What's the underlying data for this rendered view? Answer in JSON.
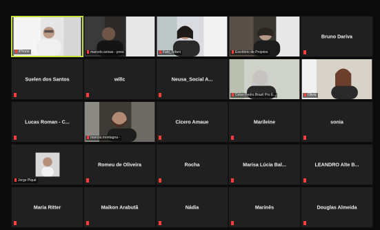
{
  "participants": [
    {
      "name": "iPhone",
      "video": true,
      "active": true
    },
    {
      "name": "marcelo.seixas - presi",
      "video": true
    },
    {
      "name": "Fabi_Tefani",
      "video": true
    },
    {
      "name": "Escritório de Projetos",
      "video": true
    },
    {
      "name": "Bruno Dariva",
      "video": false
    },
    {
      "name": "Suelen dos Santos",
      "video": false
    },
    {
      "name": "willc",
      "video": false
    },
    {
      "name": "Neusa_Social A...",
      "video": false
    },
    {
      "name": "Celso Pedro Brazil Pro E...",
      "video": true
    },
    {
      "name": "Olivia",
      "video": true
    },
    {
      "name": "Lucas Roman - C...",
      "video": false
    },
    {
      "name": "marcos.montagna -",
      "video": true
    },
    {
      "name": "Cicero Amaue",
      "video": false
    },
    {
      "name": "Marileine",
      "video": false
    },
    {
      "name": "sonia",
      "video": false
    },
    {
      "name": "Jorge Piqué",
      "video": true
    },
    {
      "name": "Romeu de Oliveira",
      "video": false
    },
    {
      "name": "Rocha",
      "video": false
    },
    {
      "name": "Marisa Lúcia Bal...",
      "video": false
    },
    {
      "name": "LEANDRO Alte B...",
      "video": false
    },
    {
      "name": "Maria Ritter",
      "video": false
    },
    {
      "name": "Maikon Arabutã",
      "video": false
    },
    {
      "name": "Nádia",
      "video": false
    },
    {
      "name": "Marinês",
      "video": false
    },
    {
      "name": "Douglas Almeida",
      "video": false
    }
  ],
  "colors": {
    "active_border": "#c6e03b",
    "muted_mic": "#ff3d3d",
    "tile_bg": "#202020"
  },
  "icons": {
    "muted": "muted-mic-icon"
  }
}
